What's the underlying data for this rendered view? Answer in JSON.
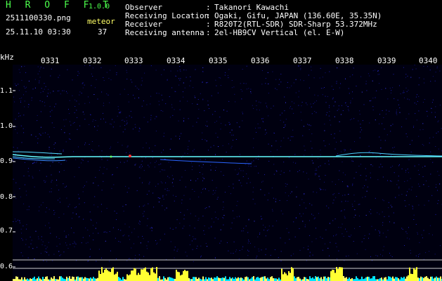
{
  "header": {
    "app_title": "H R O F F T",
    "app_version": "1.0.0",
    "file_name": "2511100330.png",
    "stat_label": "meteor",
    "date_time": "25.11.10 03:30",
    "stat_value": "37"
  },
  "info": [
    {
      "label": "Observer",
      "value": "Takanori Kawachi"
    },
    {
      "label": "Receiving Location",
      "value": "Ogaki, Gifu, JAPAN (136.60E, 35.35N)"
    },
    {
      "label": "Receiver",
      "value": "R820T2(RTL-SDR) SDR-Sharp 53.372MHz"
    },
    {
      "label": "Receiving antenna",
      "value": "2el-HB9CV Vertical (el. E-W)"
    }
  ],
  "axis": {
    "unit": "kHz",
    "y_ticks": [
      "1.1",
      "1.0",
      "0.9",
      "0.8",
      "0.7",
      "0.6"
    ],
    "x_ticks": [
      "0331",
      "0332",
      "0333",
      "0334",
      "0335",
      "0336",
      "0337",
      "0338",
      "0339",
      "0340"
    ]
  },
  "colors": {
    "green": "#4cff4c",
    "background": "#000000",
    "noise": "#1a1aa0",
    "signal": "#66ffff",
    "bar_cyan": "#00e5ff",
    "bar_yellow": "#ffff33"
  }
}
